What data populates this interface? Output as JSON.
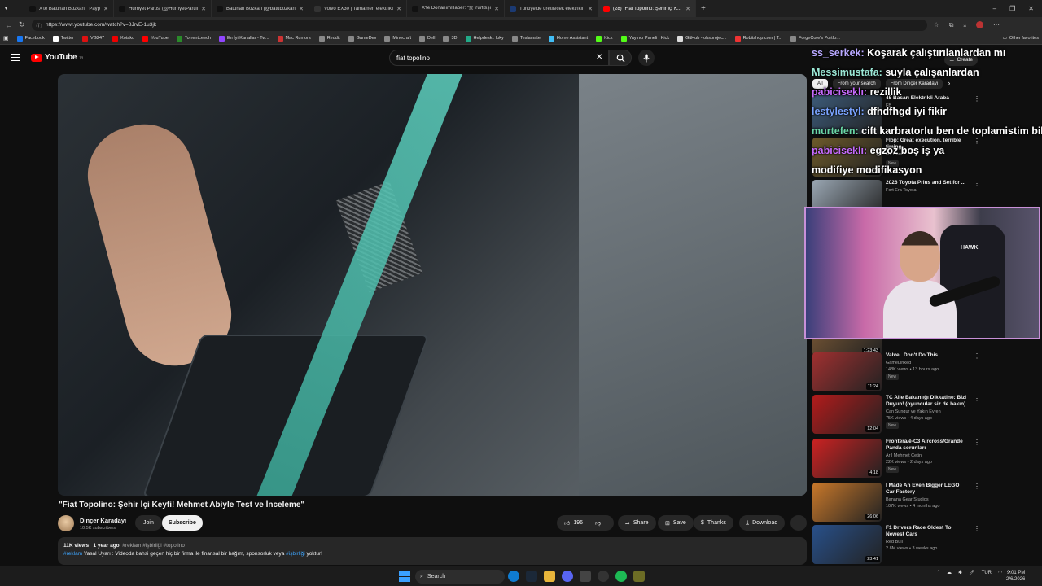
{
  "browser": {
    "tabs": [
      {
        "label": "X'te Batuhan Bozkan: \"Paypal, App...",
        "color": "#111111"
      },
      {
        "label": "Hürriyet Partisi (@HurriyetPartiliTr)",
        "color": "#111111"
      },
      {
        "label": "Batuhan Bozkan (@batubozkan) / X",
        "color": "#111111"
      },
      {
        "label": "Volvo EX30 | Tamamen elektrikli k...",
        "color": "#333333"
      },
      {
        "label": "X'te DonanımHaber: \"🇺 Yurtdışı...",
        "color": "#111111"
      },
      {
        "label": "Türkiye'de üretilecek elektrikli Hyu...",
        "color": "#1b3a73"
      },
      {
        "label": "(28) \"Fiat Topolino: Şehir İçi K...",
        "color": "#ff0000"
      }
    ],
    "url": "https://www.youtube.com/watch?v=8JrvE-1u3jk",
    "bookmarks": [
      {
        "label": "Facebook",
        "color": "#1877f2"
      },
      {
        "label": "Twitter",
        "color": "#ffffff"
      },
      {
        "label": "VG247",
        "color": "#d11"
      },
      {
        "label": "Kotaku",
        "color": "#e00"
      },
      {
        "label": "YouTube",
        "color": "#f00"
      },
      {
        "label": "TorrentLeech",
        "color": "#2a8a2a"
      },
      {
        "label": "En İyi Kanallar - Tw...",
        "color": "#9146ff"
      },
      {
        "label": "Mac Rumors",
        "color": "#c33"
      },
      {
        "label": "Reddit",
        "color": "#888"
      },
      {
        "label": "GameDev",
        "color": "#888"
      },
      {
        "label": "Minecraft",
        "color": "#888"
      },
      {
        "label": "Dell",
        "color": "#888"
      },
      {
        "label": "3D",
        "color": "#888"
      },
      {
        "label": "Helpdesk : loky",
        "color": "#2a8"
      },
      {
        "label": "Teslamate",
        "color": "#888"
      },
      {
        "label": "Home Assistant",
        "color": "#41bdf5"
      },
      {
        "label": "Kick",
        "color": "#53fc18"
      },
      {
        "label": "Yayıncı Paneli | Kick",
        "color": "#53fc18"
      },
      {
        "label": "GitHub - obsprojec...",
        "color": "#ddd"
      },
      {
        "label": "Robitshop.com | T...",
        "color": "#e33"
      },
      {
        "label": "ForgeCore's Portfo...",
        "color": "#888"
      }
    ],
    "other_favorites": "Other favorites"
  },
  "youtube": {
    "logo_text": "YouTube",
    "logo_sup": "TR",
    "search_value": "fiat topolino",
    "create_label": "Create",
    "video_title": "\"Fiat Topolino: Şehir İçi Keyfi! Mehmet Abiyle Test ve İnceleme\"",
    "channel_name": "Dinçer Karadayı",
    "subscribers": "10.5K subscribers",
    "join_label": "Join",
    "subscribe_label": "Subscribe",
    "likes": "196",
    "share_label": "Share",
    "save_label": "Save",
    "thanks_label": "Thanks",
    "download_label": "Download",
    "description": {
      "views": "11K views",
      "age": "1 year ago",
      "tags": "#reklam #işbirliği #topolino",
      "line2_tag": "#reklam",
      "line2_text": " Yasal Uyarı : Videoda bahsi geçen hiç bir firma ile finansal bir bağım, sponsorluk veya ",
      "line2_tag2": "#işbirliği",
      "line2_end": " yoktur!"
    }
  },
  "sidebar": {
    "chips": [
      "All",
      "From your search",
      "From Dinçer Karadayı"
    ],
    "recommendations": [
      {
        "title": "45 Basarı Elektrikli Araba",
        "channel": "FB",
        "meta": "",
        "duration": "",
        "new": false,
        "color": "#3c5a78"
      },
      {
        "title": "Flop: Great execution, terrible timing",
        "channel": "HT Cars",
        "meta": "",
        "duration": "10:50",
        "new": true,
        "color": "#6d5a2a"
      },
      {
        "title": "2026 Toyota Prius and Set for ...",
        "channel": "Fort Era Toyota",
        "meta": "",
        "duration": "",
        "new": false,
        "color": "#9aa7b3"
      },
      {
        "title": "",
        "channel": "",
        "meta": "150K views • 1 month ago",
        "duration": "1:23:43",
        "new": false,
        "color": "#7d5a36"
      },
      {
        "title": "Valve...Don't Do This",
        "channel": "GameLinked",
        "meta": "148K views • 13 hours ago",
        "duration": "11:24",
        "new": true,
        "color": "#a03030"
      },
      {
        "title": "TC Aile Bakanlığı Dikkatine: Bizi Duyun! (oyuncular siz de bakın)",
        "channel": "Can Sungur ve Yakın Evren",
        "meta": "75K views • 4 days ago",
        "duration": "12:04",
        "new": true,
        "color": "#b31b1b"
      },
      {
        "title": "Frontera/ë-C3 Aircross/Grande Panda sorunları",
        "channel": "Arıl Mehmet Çetin",
        "meta": "22K views • 2 days ago",
        "duration": "4:18",
        "new": true,
        "color": "#cc2222"
      },
      {
        "title": "I Made An Even Bigger LEGO Car Factory",
        "channel": "Banana Gear Studios",
        "meta": "107K views • 4 months ago",
        "duration": "26:06",
        "new": false,
        "color": "#c8782a"
      },
      {
        "title": "F1 Drivers Race Oldest To Newest Cars",
        "channel": "Red Bull",
        "meta": "2.8M views • 3 weeks ago",
        "duration": "23:41",
        "new": false,
        "color": "#28508a"
      }
    ]
  },
  "chat": [
    {
      "user": "ss_serkek:",
      "text": " Koşarak çalıştırılanlardan mı",
      "color": "#b8a8ff"
    },
    {
      "user": "Messimustafa:",
      "text": " suyla çalışanlardan",
      "color": "#9be8d6"
    },
    {
      "user": "pabiciseklı:",
      "text": " rezillik",
      "color": "#c76bff"
    },
    {
      "user": "lestylestyl:",
      "text": " dfhdfhgd iyi fikir",
      "color": "#7aa3ff"
    },
    {
      "user": "murtefen:",
      "text": " cift karbratorlu ben de toplamistim biliyom",
      "color": "#6ad6a6"
    },
    {
      "user": "pabiciseklı:",
      "text": " egzoz boş iş ya",
      "color": "#c76bff"
    },
    {
      "user": "",
      "text": " modifiye modifikasyon",
      "color": "#ffffff"
    }
  ],
  "webcam": {
    "brand_text": "HAWK"
  },
  "taskbar": {
    "search_label": "Search",
    "tray_lang": "TUR",
    "time": "9:01 PM",
    "date": "2/6/2026"
  }
}
